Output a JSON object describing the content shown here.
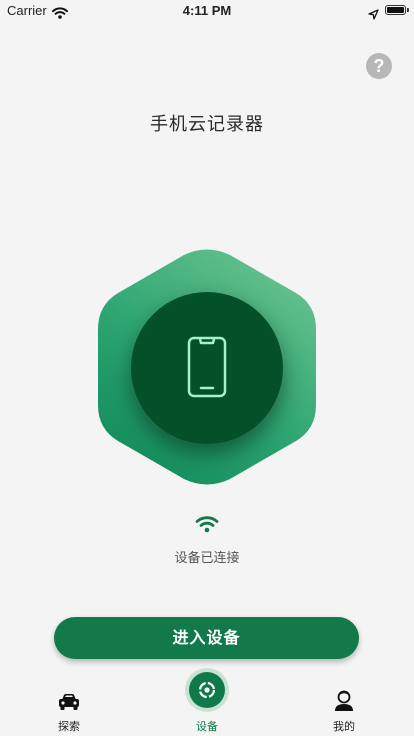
{
  "status_bar": {
    "carrier": "Carrier",
    "time": "4:11 PM"
  },
  "header": {
    "help_label": "?",
    "title": "手机云记录器"
  },
  "device": {
    "connection_status": "设备已连接"
  },
  "actions": {
    "enter_label": "进入设备"
  },
  "tabs": [
    {
      "label": "探索",
      "icon": "car-icon"
    },
    {
      "label": "设备",
      "icon": "device-icon",
      "active": true
    },
    {
      "label": "我的",
      "icon": "person-icon"
    }
  ],
  "colors": {
    "accent": "#11794a",
    "hex_light": "#6cc491",
    "hex_dark": "#128a5a",
    "inner_circle": "#045028",
    "phone_stroke": "#a8f0c8"
  }
}
